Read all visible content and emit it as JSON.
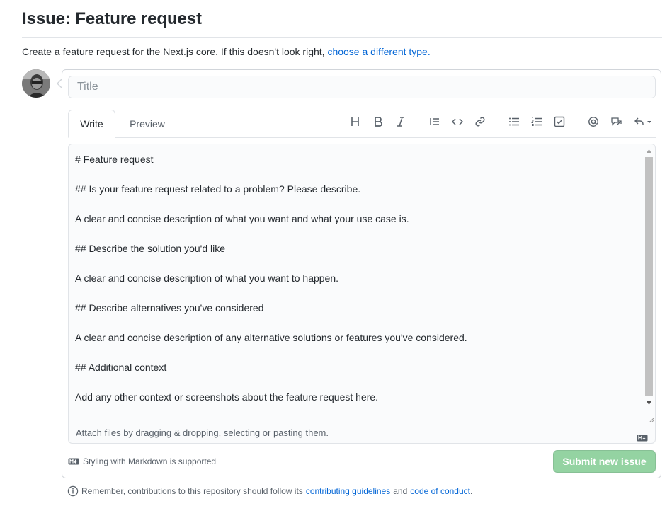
{
  "page": {
    "title": "Issue: Feature request",
    "intro_text": "Create a feature request for the Next.js core. If this doesn't look right,",
    "intro_link": "choose a different type."
  },
  "form": {
    "title_placeholder": "Title",
    "tabs": [
      {
        "label": "Write"
      },
      {
        "label": "Preview"
      }
    ],
    "toolbar": [
      "heading-icon",
      "bold-icon",
      "italic-icon",
      "quote-icon",
      "code-icon",
      "link-icon",
      "bulleted-list-icon",
      "numbered-list-icon",
      "task-list-icon",
      "mention-icon",
      "reference-icon",
      "reply-icon"
    ],
    "body_lines": [
      "# Feature request",
      "",
      "## Is your feature request related to a problem? Please describe.",
      "",
      "A clear and concise description of what you want and what your use case is.",
      "",
      "## Describe the solution you'd like",
      "",
      "A clear and concise description of what you want to happen.",
      "",
      "## Describe alternatives you've considered",
      "",
      "A clear and concise description of any alternative solutions or features you've considered.",
      "",
      "## Additional context",
      "",
      "Add any other context or screenshots about the feature request here."
    ],
    "attach_text": "Attach files by dragging & dropping, selecting or pasting them.",
    "markdown_note": "Styling with Markdown is supported",
    "submit_label": "Submit new issue"
  },
  "footer": {
    "text_before": "Remember, contributions to this repository should follow its",
    "link_guidelines": "contributing guidelines",
    "text_and": "and",
    "link_conduct": "code of conduct",
    "text_end": "."
  },
  "colors": {
    "link": "#0366d6",
    "submit_disabled": "#94d3a2"
  }
}
